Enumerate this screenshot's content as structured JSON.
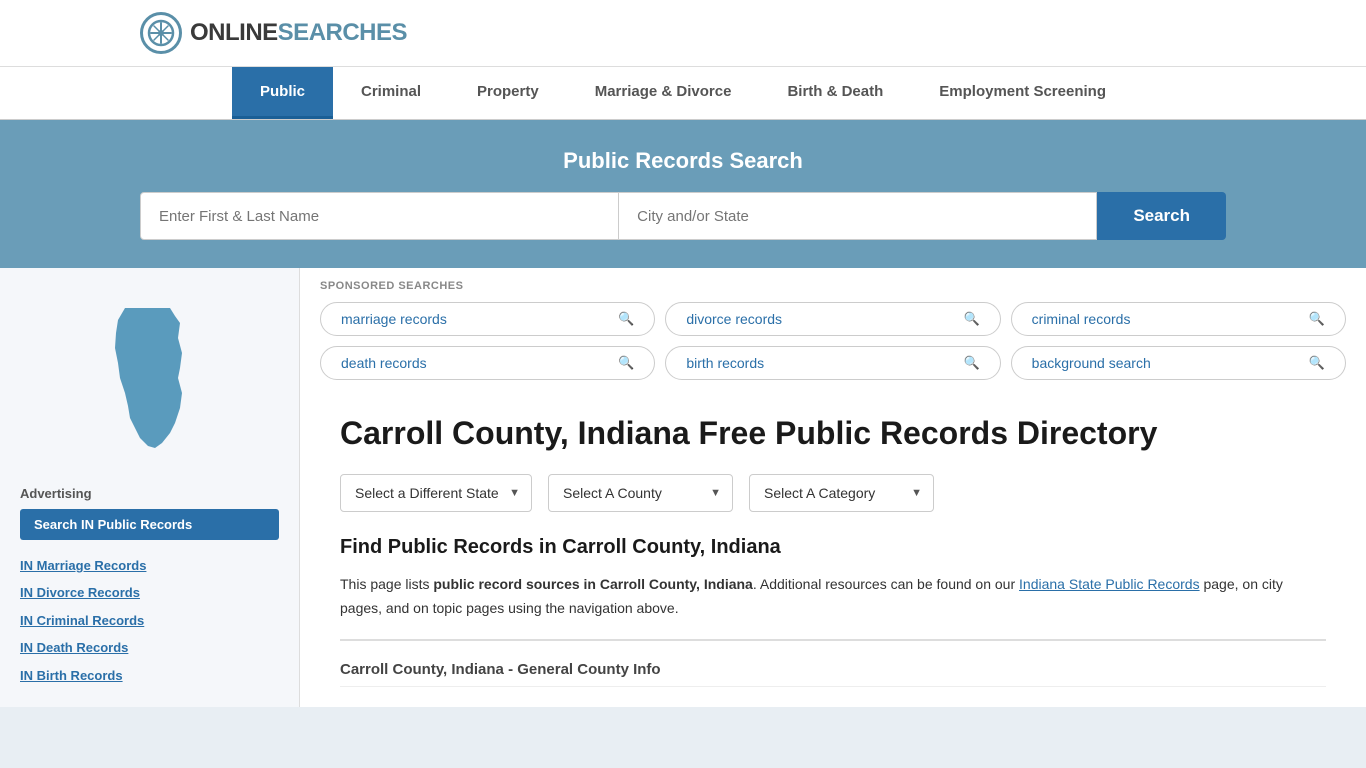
{
  "header": {
    "logo_online": "ONLINE",
    "logo_searches": "SEARCHES"
  },
  "nav": {
    "items": [
      {
        "label": "Public",
        "active": true
      },
      {
        "label": "Criminal",
        "active": false
      },
      {
        "label": "Property",
        "active": false
      },
      {
        "label": "Marriage & Divorce",
        "active": false
      },
      {
        "label": "Birth & Death",
        "active": false
      },
      {
        "label": "Employment Screening",
        "active": false
      }
    ]
  },
  "hero": {
    "title": "Public Records Search",
    "name_placeholder": "Enter First & Last Name",
    "city_placeholder": "City and/or State",
    "search_label": "Search"
  },
  "sponsored": {
    "label": "SPONSORED SEARCHES",
    "tags": [
      {
        "label": "marriage records"
      },
      {
        "label": "divorce records"
      },
      {
        "label": "criminal records"
      },
      {
        "label": "death records"
      },
      {
        "label": "birth records"
      },
      {
        "label": "background search"
      }
    ]
  },
  "sidebar": {
    "advertising_label": "Advertising",
    "ad_button_label": "Search IN Public Records",
    "links": [
      {
        "label": "IN Marriage Records"
      },
      {
        "label": "IN Divorce Records"
      },
      {
        "label": "IN Criminal Records"
      },
      {
        "label": "IN Death Records"
      },
      {
        "label": "IN Birth Records"
      }
    ]
  },
  "content": {
    "page_title": "Carroll County, Indiana Free Public Records Directory",
    "dropdowns": {
      "state": "Select a Different State",
      "county": "Select A County",
      "category": "Select A Category"
    },
    "section_heading": "Find Public Records in Carroll County, Indiana",
    "description_part1": "This page lists ",
    "description_bold": "public record sources in Carroll County, Indiana",
    "description_part2": ". Additional resources can be found on our ",
    "description_link": "Indiana State Public Records",
    "description_part3": " page, on city pages, and on topic pages using the navigation above.",
    "county_info_title": "Carroll County, Indiana - General County Info"
  }
}
